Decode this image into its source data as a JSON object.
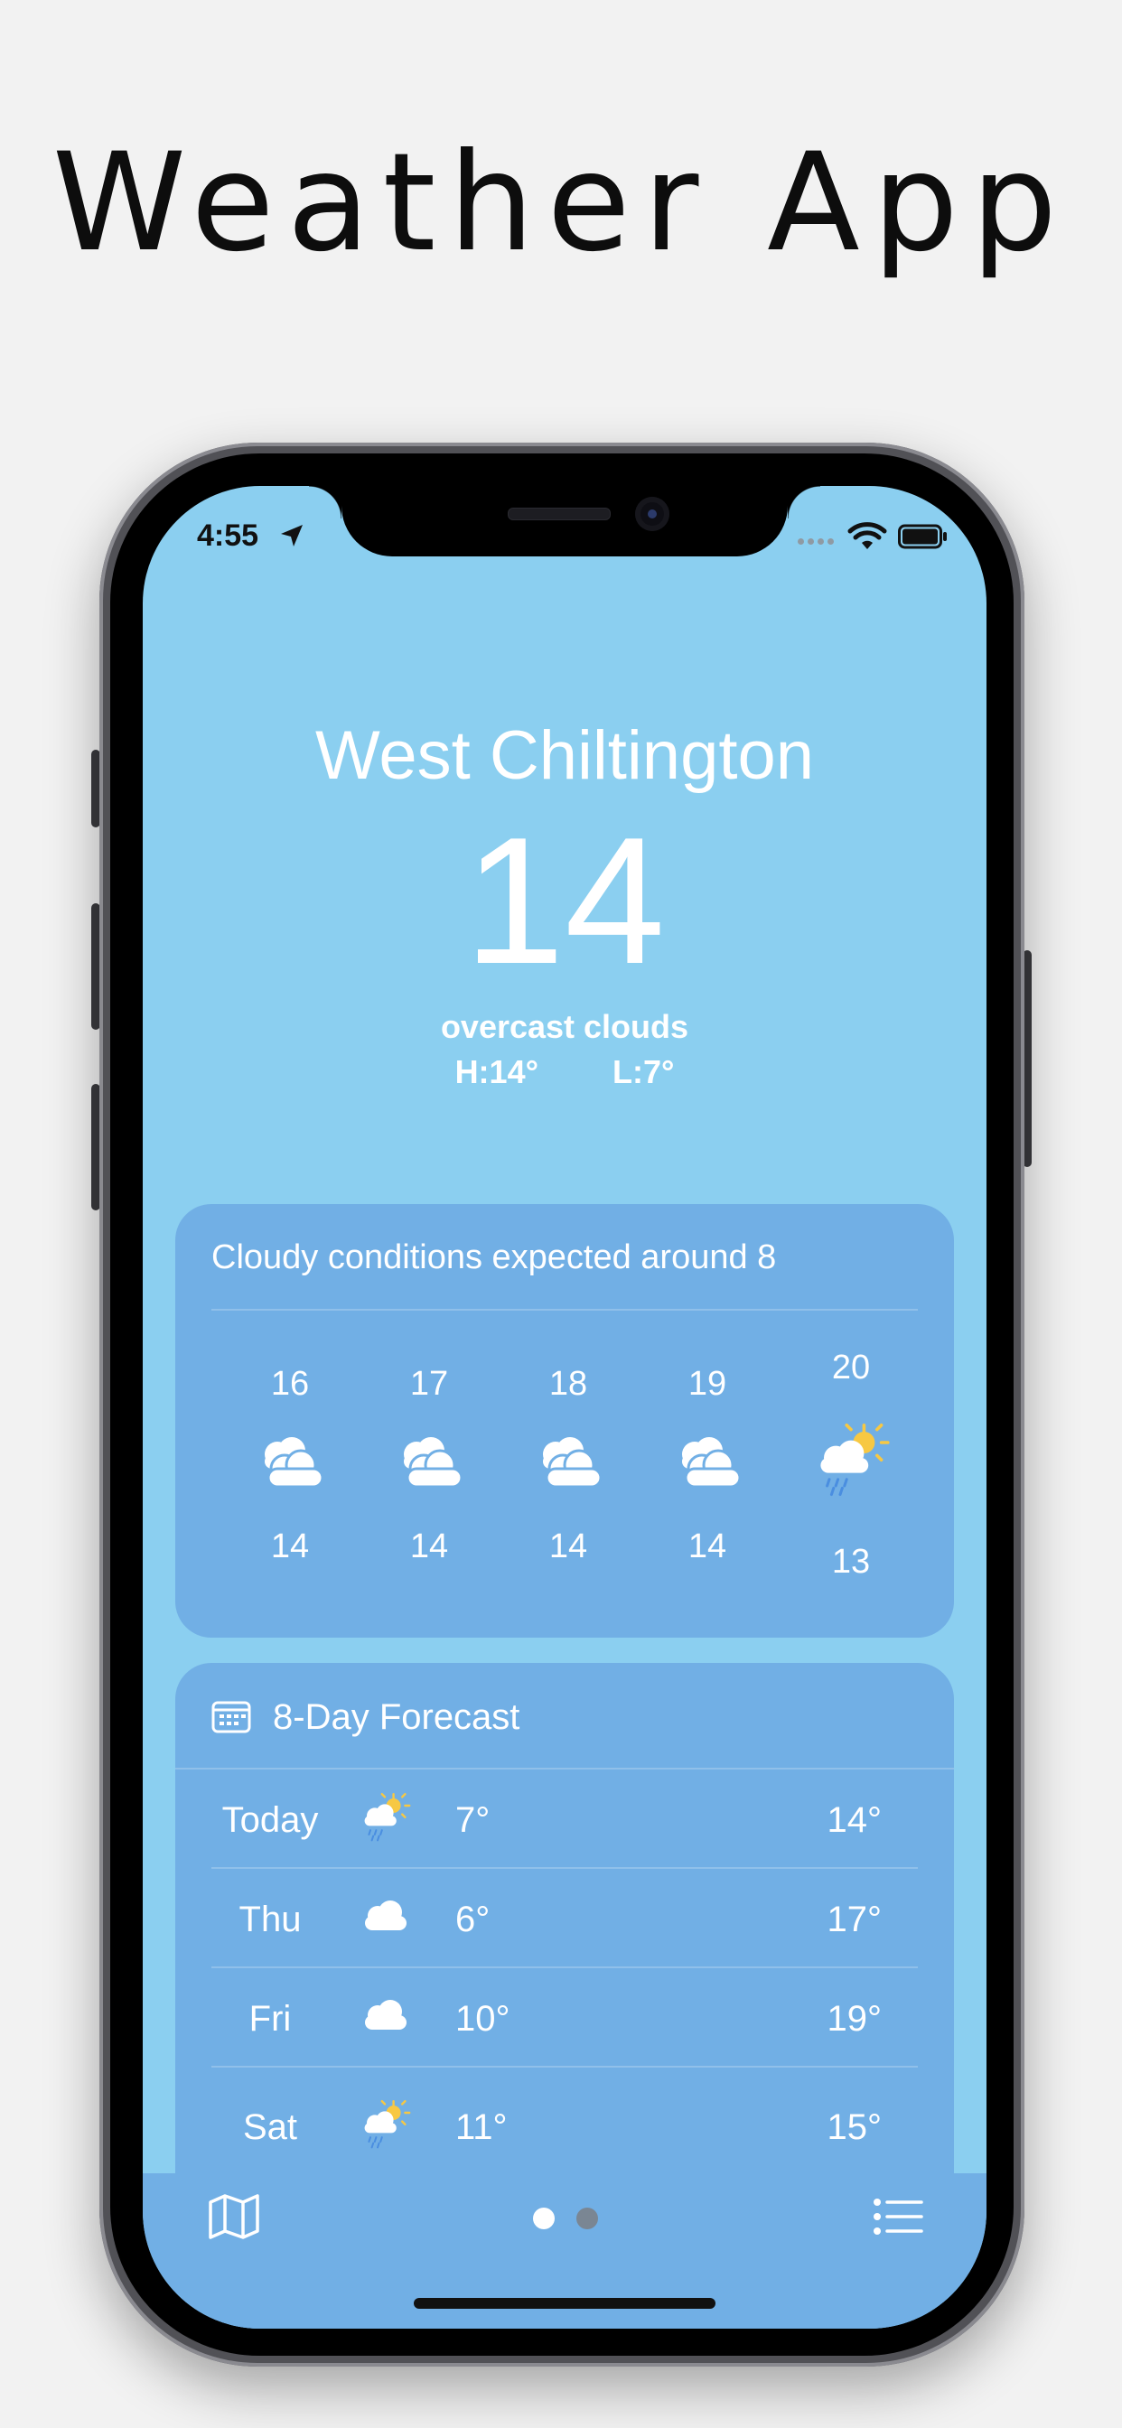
{
  "promo": {
    "title": "Weather App"
  },
  "status_bar": {
    "time": "4:55"
  },
  "current": {
    "city": "West Chiltington",
    "temperature": "14",
    "description": "overcast clouds",
    "high": "H:14°",
    "low": "L:7°"
  },
  "hourly": {
    "summary": "Cloudy conditions expected around 8",
    "hours": [
      {
        "hour": "16",
        "temp": "14",
        "icon": "cloud-icon"
      },
      {
        "hour": "17",
        "temp": "14",
        "icon": "cloud-icon"
      },
      {
        "hour": "18",
        "temp": "14",
        "icon": "cloud-icon"
      },
      {
        "hour": "19",
        "temp": "14",
        "icon": "cloud-icon"
      },
      {
        "hour": "20",
        "temp": "13",
        "icon": "sun-rain-icon"
      }
    ]
  },
  "forecast": {
    "title": "8-Day Forecast",
    "days": [
      {
        "day": "Today",
        "low": "7°",
        "high": "14°",
        "icon": "sun-rain-icon"
      },
      {
        "day": "Thu",
        "low": "6°",
        "high": "17°",
        "icon": "cloud-icon"
      },
      {
        "day": "Fri",
        "low": "10°",
        "high": "19°",
        "icon": "cloud-icon"
      },
      {
        "day": "Sat",
        "low": "11°",
        "high": "15°",
        "icon": "sun-rain-icon"
      }
    ]
  },
  "tabbar": {
    "icons": [
      "map-icon",
      "page-dot",
      "list-icon"
    ],
    "page_count": 2,
    "active_page": 1
  },
  "colors": {
    "sky": "#8bcff0",
    "card": "#71afe5",
    "sun": "#f7c843",
    "rain": "#4a8ee0"
  }
}
